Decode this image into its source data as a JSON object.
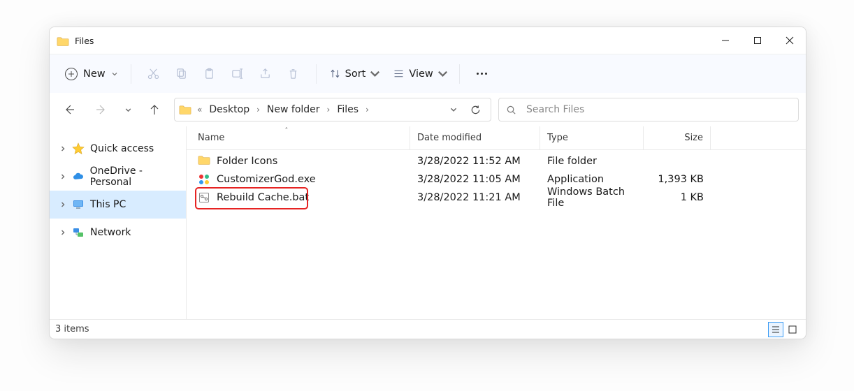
{
  "window": {
    "title": "Files"
  },
  "toolbar": {
    "new_label": "New",
    "sort_label": "Sort",
    "view_label": "View"
  },
  "breadcrumb": [
    "Desktop",
    "New folder",
    "Files"
  ],
  "search": {
    "placeholder": "Search Files"
  },
  "sidebar": {
    "items": [
      {
        "label": "Quick access"
      },
      {
        "label": "OneDrive - Personal"
      },
      {
        "label": "This PC"
      },
      {
        "label": "Network"
      }
    ]
  },
  "columns": {
    "name": "Name",
    "date": "Date modified",
    "type": "Type",
    "size": "Size"
  },
  "files": [
    {
      "name": "Folder Icons",
      "date": "3/28/2022 11:52 AM",
      "type": "File folder",
      "size": ""
    },
    {
      "name": "CustomizerGod.exe",
      "date": "3/28/2022 11:05 AM",
      "type": "Application",
      "size": "1,393 KB"
    },
    {
      "name": "Rebuild Cache.bat",
      "date": "3/28/2022 11:21 AM",
      "type": "Windows Batch File",
      "size": "1 KB"
    }
  ],
  "status": {
    "count_text": "3 items"
  }
}
